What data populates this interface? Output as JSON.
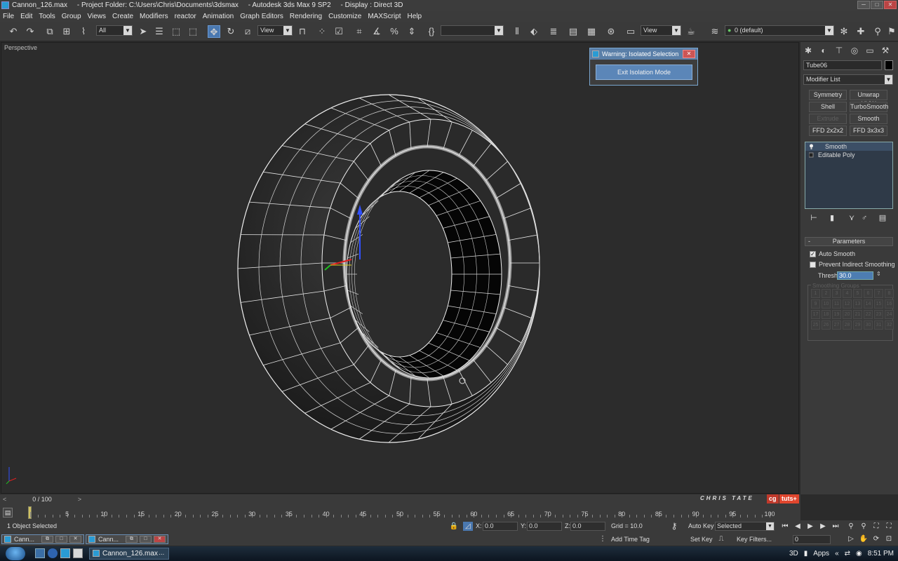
{
  "window": {
    "title": "Cannon_126.max     - Project Folder: C:\\Users\\Chris\\Documents\\3dsmax     - Autodesk 3ds Max 9 SP2     - Display : Direct 3D"
  },
  "menu": [
    "File",
    "Edit",
    "Tools",
    "Group",
    "Views",
    "Create",
    "Modifiers",
    "reactor",
    "Animation",
    "Graph Editors",
    "Rendering",
    "Customize",
    "MAXScript",
    "Help"
  ],
  "toolbar": {
    "selection_filter": "All",
    "ref_coord": "View",
    "named_sel": "",
    "ref_coord2": "View",
    "layer": "0 (default)"
  },
  "viewport": {
    "label": "Perspective"
  },
  "warning_dialog": {
    "title": "Warning: Isolated Selection",
    "button": "Exit Isolation Mode"
  },
  "command_panel": {
    "object_name": "Tube06",
    "object_color": "#000000",
    "modifier_list": "Modifier List",
    "modifier_buttons": [
      "Symmetry",
      "Unwrap UVW",
      "Shell",
      "TurboSmooth",
      "Extrude",
      "Smooth",
      "FFD 2x2x2",
      "FFD 3x3x3"
    ],
    "stack": [
      "Smooth",
      "Editable Poly"
    ],
    "params_title": "Parameters",
    "auto_smooth": "Auto Smooth",
    "auto_smooth_checked": true,
    "prevent_indirect": "Prevent Indirect Smoothing",
    "threshold_label": "Threshold:",
    "threshold_value": "30.0",
    "smoothing_groups_label": "Smoothing Groups",
    "smoothing_groups": [
      "1",
      "2",
      "3",
      "4",
      "5",
      "6",
      "7",
      "8",
      "9",
      "10",
      "11",
      "12",
      "13",
      "14",
      "15",
      "16",
      "17",
      "18",
      "19",
      "20",
      "21",
      "22",
      "23",
      "24",
      "25",
      "26",
      "27",
      "28",
      "29",
      "30",
      "31",
      "32"
    ]
  },
  "timeline": {
    "frame_label": "0 / 100",
    "brand": "CHRIS TATE",
    "logo1": "cg",
    "logo2": "tuts+",
    "ticks": [
      "0",
      "5",
      "10",
      "15",
      "20",
      "25",
      "30",
      "35",
      "40",
      "45",
      "50",
      "55",
      "60",
      "65",
      "70",
      "75",
      "80",
      "85",
      "90",
      "95",
      "100"
    ]
  },
  "status": {
    "selected_count": "1 Object Selected",
    "x_label": "X:",
    "x_value": "0.0",
    "y_label": "Y:",
    "y_value": "0.0",
    "z_label": "Z:",
    "z_value": "0.0",
    "grid": "Grid = 10.0",
    "add_time_tag": "Add Time Tag",
    "auto_key": "Auto Key",
    "set_key": "Set Key",
    "key_mode": "Selected",
    "key_filters": "Key Filters...",
    "current_frame": "0"
  },
  "minimized_windows": [
    "Cann...",
    "Cann..."
  ],
  "taskbar": {
    "app_item": "Cannon_126.max",
    "more": "...",
    "tray_3d": "3D",
    "tray_apps": "Apps",
    "clock": "8:51 PM"
  }
}
